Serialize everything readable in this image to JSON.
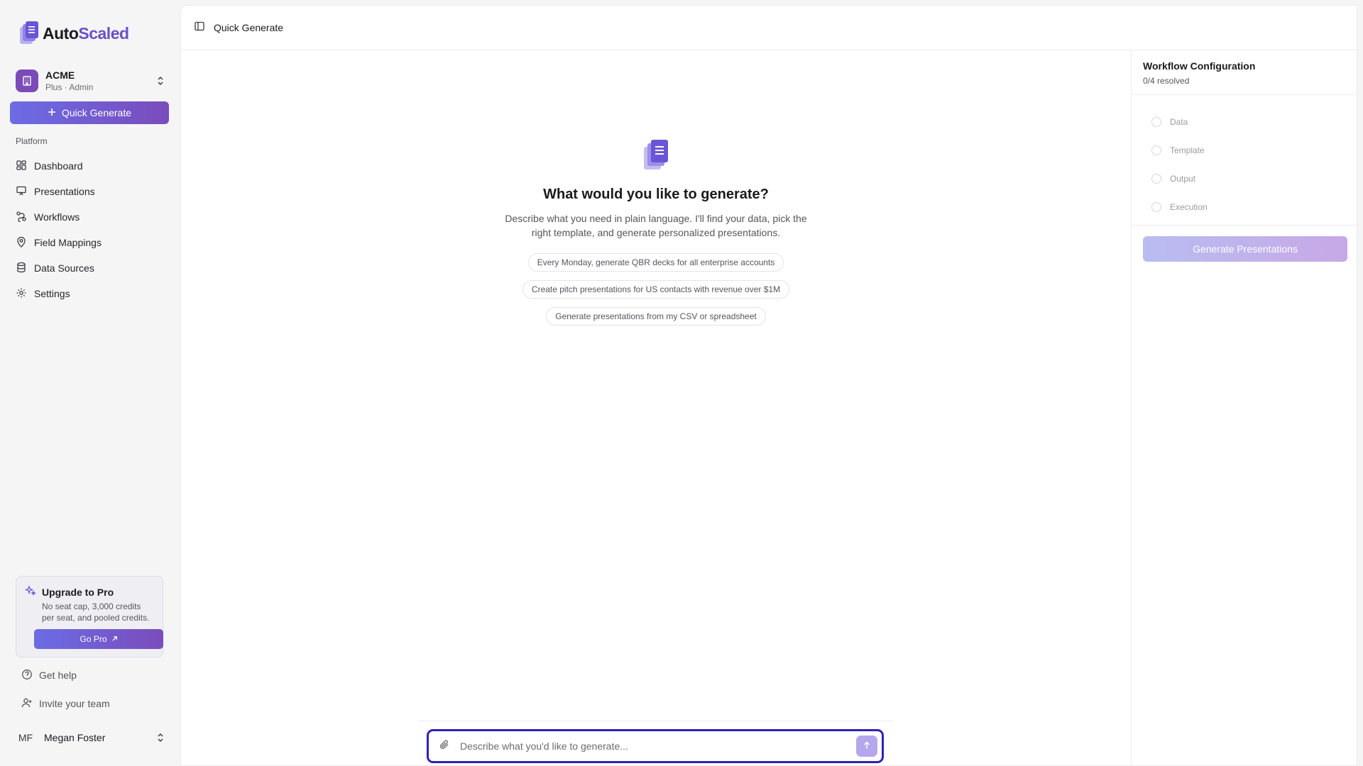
{
  "brand": {
    "part1": "Auto",
    "part2": "Scaled"
  },
  "workspace": {
    "name": "ACME",
    "subtitle": "Plus · Admin"
  },
  "sidebar": {
    "quick_generate_label": "Quick Generate",
    "section_label": "Platform",
    "items": [
      {
        "label": "Dashboard",
        "icon": "grid-icon"
      },
      {
        "label": "Presentations",
        "icon": "presentation-icon"
      },
      {
        "label": "Workflows",
        "icon": "workflow-icon"
      },
      {
        "label": "Field Mappings",
        "icon": "map-pin-icon"
      },
      {
        "label": "Data Sources",
        "icon": "database-icon"
      },
      {
        "label": "Settings",
        "icon": "gear-icon"
      }
    ],
    "upgrade": {
      "title": "Upgrade to Pro",
      "description": "No seat cap, 3,000 credits per seat, and pooled credits.",
      "button": "Go Pro"
    },
    "help_label": "Get help",
    "invite_label": "Invite your team",
    "user": {
      "initials": "MF",
      "name": "Megan Foster"
    }
  },
  "header": {
    "title": "Quick Generate"
  },
  "main": {
    "heading": "What would you like to generate?",
    "description": "Describe what you need in plain language. I'll find your data, pick the right template, and generate personalized presentations.",
    "suggestions": [
      "Every Monday, generate QBR decks for all enterprise accounts",
      "Create pitch presentations for US contacts with revenue over $1M",
      "Generate presentations from my CSV or spreadsheet"
    ],
    "composer": {
      "placeholder": "Describe what you'd like to generate...",
      "value": ""
    }
  },
  "config": {
    "title": "Workflow Configuration",
    "status": "0/4 resolved",
    "steps": [
      "Data",
      "Template",
      "Output",
      "Execution"
    ],
    "generate_button": "Generate Presentations"
  },
  "colors": {
    "accent": "#6c6ce4",
    "accent_end": "#7a4cbc",
    "focus_ring": "#2d22b8",
    "workspace_avatar": "#7b4bb8"
  }
}
